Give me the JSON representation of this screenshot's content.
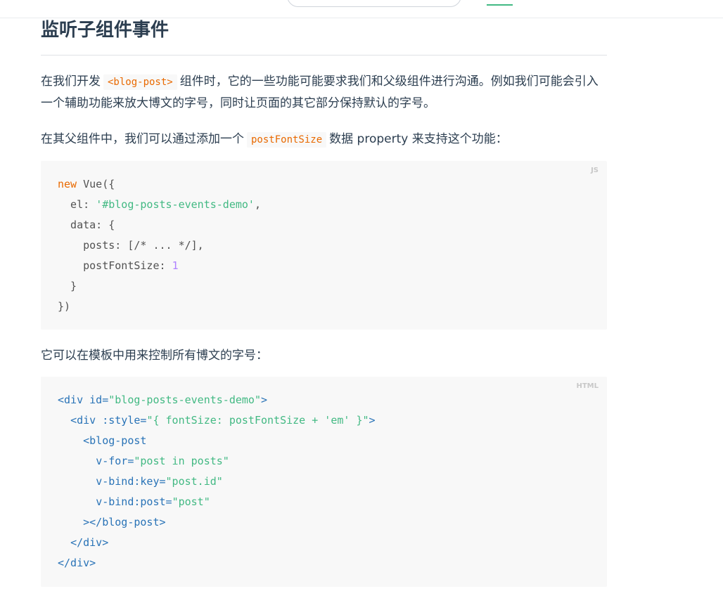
{
  "topbar": {
    "search_placeholder": ""
  },
  "section": {
    "heading": "监听子组件事件",
    "para1": {
      "before": "在我们开发",
      "code": "<blog-post>",
      "after": "组件时，它的一些功能可能要求我们和父级组件进行沟通。例如我们可能会引入一个辅助功能来放大博文的字号，同时让页面的其它部分保持默认的字号。"
    },
    "para2": {
      "before": "在其父组件中，我们可以通过添加一个",
      "code": "postFontSize",
      "after": "数据 property 来支持这个功能："
    },
    "para3": "它可以在模板中用来控制所有博文的字号：",
    "code_js": {
      "lang": "JS",
      "lines": [
        [
          {
            "t": "new",
            "c": "kw"
          },
          {
            "t": " Vue({"
          }
        ],
        [
          {
            "t": "  el: "
          },
          {
            "t": "'#blog-posts-events-demo'",
            "c": "str"
          },
          {
            "t": ","
          }
        ],
        [
          {
            "t": "  data: {"
          }
        ],
        [
          {
            "t": "    posts: [/* ... */],"
          }
        ],
        [
          {
            "t": "    postFontSize: "
          },
          {
            "t": "1",
            "c": "num"
          }
        ],
        [
          {
            "t": "  }"
          }
        ],
        [
          {
            "t": "})"
          }
        ]
      ]
    },
    "code_html": {
      "lang": "HTML",
      "lines": [
        [
          {
            "t": "<div",
            "c": "tag"
          },
          {
            "t": " id=",
            "c": "attr"
          },
          {
            "t": "\"blog-posts-events-demo\"",
            "c": "str"
          },
          {
            "t": ">",
            "c": "tag"
          }
        ],
        [
          {
            "t": "  "
          },
          {
            "t": "<div",
            "c": "tag"
          },
          {
            "t": " :style=",
            "c": "attr"
          },
          {
            "t": "\"{ fontSize: postFontSize + 'em' }\"",
            "c": "str"
          },
          {
            "t": ">",
            "c": "tag"
          }
        ],
        [
          {
            "t": "    "
          },
          {
            "t": "<blog-post",
            "c": "tag"
          }
        ],
        [
          {
            "t": "      "
          },
          {
            "t": "v-for=",
            "c": "attr"
          },
          {
            "t": "\"post in posts\"",
            "c": "str"
          }
        ],
        [
          {
            "t": "      "
          },
          {
            "t": "v-bind:key=",
            "c": "attr"
          },
          {
            "t": "\"post.id\"",
            "c": "str"
          }
        ],
        [
          {
            "t": "      "
          },
          {
            "t": "v-bind:post=",
            "c": "attr"
          },
          {
            "t": "\"post\"",
            "c": "str"
          }
        ],
        [
          {
            "t": "    "
          },
          {
            "t": "></blog-post>",
            "c": "tag"
          }
        ],
        [
          {
            "t": "  "
          },
          {
            "t": "</div>",
            "c": "tag"
          }
        ],
        [
          {
            "t": "</div>",
            "c": "tag"
          }
        ]
      ]
    }
  }
}
